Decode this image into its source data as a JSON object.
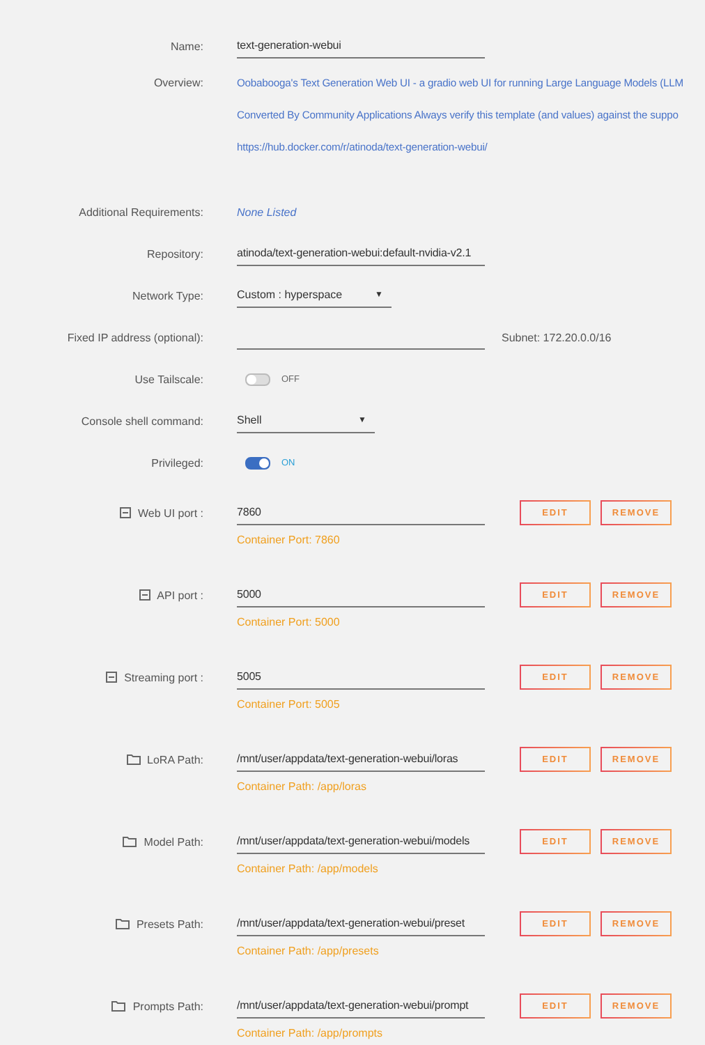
{
  "fields": [
    {
      "kind": "text",
      "label": "Name:",
      "value": "text-generation-webui"
    },
    {
      "kind": "overview",
      "label": "Overview:",
      "lines": [
        "Oobabooga's Text Generation Web UI - a gradio web UI for running Large Language Models (LLM",
        "Converted By Community Applications Always verify this template (and values) against the suppo",
        "https://hub.docker.com/r/atinoda/text-generation-webui/"
      ]
    },
    {
      "kind": "note",
      "label": "Additional Requirements:",
      "value": "None Listed"
    },
    {
      "kind": "text",
      "label": "Repository:",
      "value": "atinoda/text-generation-webui:default-nvidia-v2.1"
    },
    {
      "kind": "select",
      "label": "Network Type:",
      "value": "Custom : hyperspace",
      "caret": "▼"
    },
    {
      "kind": "text",
      "label": "Fixed IP address (optional):",
      "aside": "Subnet: 172.20.0.0/16"
    },
    {
      "kind": "toggle",
      "label": "Use Tailscale:",
      "on": false,
      "state_text": "OFF"
    },
    {
      "kind": "select",
      "label": "Console shell command:",
      "value": "Shell",
      "caret": "▼"
    },
    {
      "kind": "toggle",
      "label": "Privileged:",
      "on": true,
      "state_text": "ON"
    }
  ],
  "mappings": [
    {
      "kind": "port",
      "label": "Web UI port :",
      "value": "7860",
      "container": "Container Port: 7860",
      "buttons": [
        "EDIT",
        "REMOVE"
      ]
    },
    {
      "kind": "port",
      "label": "API port :",
      "value": "5000",
      "container": "Container Port: 5000",
      "buttons": [
        "EDIT",
        "REMOVE"
      ]
    },
    {
      "kind": "port",
      "label": "Streaming port :",
      "value": "5005",
      "container": "Container Port: 5005",
      "buttons": [
        "EDIT",
        "REMOVE"
      ]
    },
    {
      "kind": "path",
      "label": "LoRA Path:",
      "value": "/mnt/user/appdata/text-generation-webui/loras",
      "container": "Container Path: /app/loras",
      "buttons": [
        "EDIT",
        "REMOVE"
      ]
    },
    {
      "kind": "path",
      "label": "Model Path:",
      "value": "/mnt/user/appdata/text-generation-webui/models",
      "container": "Container Path: /app/models",
      "buttons": [
        "EDIT",
        "REMOVE"
      ]
    },
    {
      "kind": "path",
      "label": "Presets Path:",
      "value": "/mnt/user/appdata/text-generation-webui/preset",
      "container": "Container Path: /app/presets",
      "buttons": [
        "EDIT",
        "REMOVE"
      ]
    },
    {
      "kind": "path",
      "label": "Prompts Path:",
      "value": "/mnt/user/appdata/text-generation-webui/prompt",
      "container": "Container Path: /app/prompts",
      "buttons": [
        "EDIT",
        "REMOVE"
      ]
    }
  ]
}
